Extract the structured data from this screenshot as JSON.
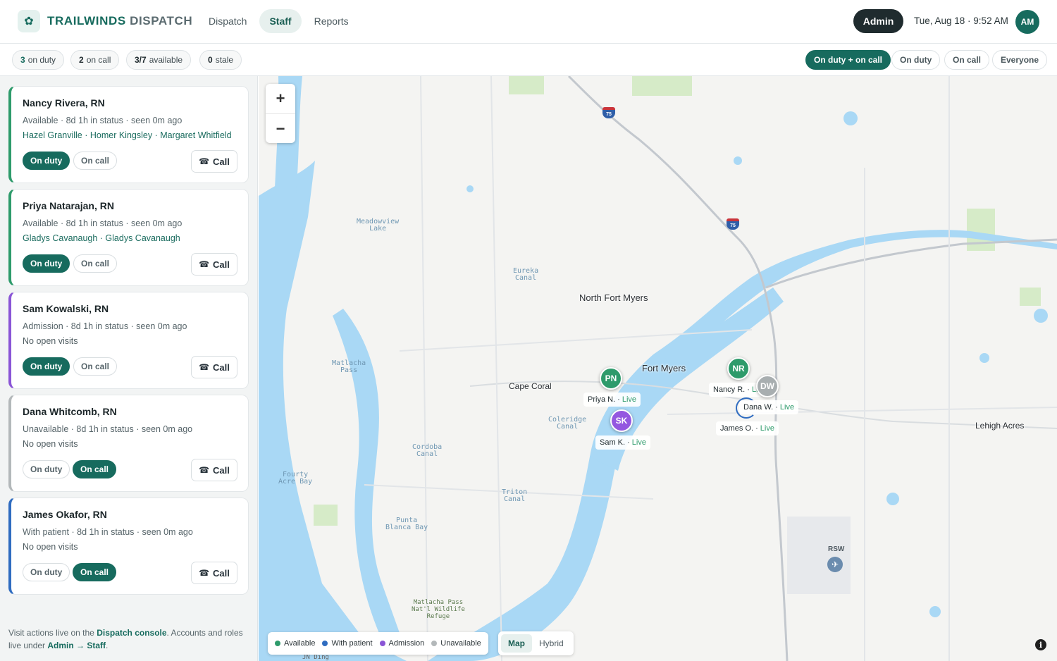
{
  "header": {
    "brand_primary": "TRAILWINDS",
    "brand_secondary": "DISPATCH",
    "brand_icon": "butterfly-icon",
    "tabs": [
      {
        "label": "Dispatch",
        "active": false
      },
      {
        "label": "Staff",
        "active": true
      },
      {
        "label": "Reports",
        "active": false
      }
    ],
    "admin_label": "Admin",
    "datetime": "Tue, Aug 18 · 9:52 AM",
    "avatar_initials": "AM"
  },
  "stats": [
    {
      "count": "3",
      "label": "on duty"
    },
    {
      "count": "2",
      "label": "on call"
    },
    {
      "count": "3/7",
      "label": "available"
    },
    {
      "count": "0",
      "label": "stale"
    }
  ],
  "filters": [
    {
      "label": "On duty + on call",
      "active": true
    },
    {
      "label": "On duty",
      "active": false
    },
    {
      "label": "On call",
      "active": false
    },
    {
      "label": "Everyone",
      "active": false
    }
  ],
  "staff": [
    {
      "name": "Nancy Rivera, RN",
      "status": "Available · 8d 1h in status · seen 0m ago",
      "visits": "Hazel Granville · Homer Kingsley · Margaret Whitfield",
      "on_duty_label": "On duty",
      "on_call_label": "On call",
      "mode": "on_duty",
      "call_label": "Call",
      "kind": "available"
    },
    {
      "name": "Priya Natarajan, RN",
      "status": "Available · 8d 1h in status · seen 0m ago",
      "visits": "Gladys Cavanaugh · Gladys Cavanaugh",
      "on_duty_label": "On duty",
      "on_call_label": "On call",
      "mode": "on_duty",
      "call_label": "Call",
      "kind": "available"
    },
    {
      "name": "Sam Kowalski, RN",
      "status": "Admission · 8d 1h in status · seen 0m ago",
      "visits": "No open visits",
      "on_duty_label": "On duty",
      "on_call_label": "On call",
      "mode": "on_duty",
      "call_label": "Call",
      "kind": "admission"
    },
    {
      "name": "Dana Whitcomb, RN",
      "status": "Unavailable · 8d 1h in status · seen 0m ago",
      "visits": "No open visits",
      "on_duty_label": "On duty",
      "on_call_label": "On call",
      "mode": "on_call",
      "call_label": "Call",
      "kind": "unavailable"
    },
    {
      "name": "James Okafor, RN",
      "status": "With patient · 8d 1h in status · seen 0m ago",
      "visits": "No open visits",
      "on_duty_label": "On duty",
      "on_call_label": "On call",
      "mode": "on_call",
      "call_label": "Call",
      "kind": "with_patient"
    }
  ],
  "footer": {
    "t1": "Visit actions live on the ",
    "link1": "Dispatch console",
    "t2": ". Accounts and roles live under ",
    "link2": "Admin → Staff",
    "t3": "."
  },
  "map": {
    "zoom_in": "+",
    "zoom_out": "−",
    "places": {
      "north_fort_myers": "North Fort Myers",
      "fort_myers": "Fort Myers",
      "cape_coral": "Cape Coral",
      "lehigh_acres": "Lehigh Acres"
    },
    "water": {
      "meadowview_1": "Meadowview",
      "meadowview_2": "Lake",
      "eureka_1": "Eureka",
      "eureka_2": "Canal",
      "matlacha_1": "Matlacha",
      "matlacha_2": "Pass",
      "coleridge_1": "Coleridge",
      "coleridge_2": "Canal",
      "cordoba_1": "Cordoba",
      "cordoba_2": "Canal",
      "fourty_1": "Fourty",
      "fourty_2": "Acre Bay",
      "triton_1": "Triton",
      "triton_2": "Canal",
      "punta_1": "Punta",
      "punta_2": "Blanca Bay"
    },
    "park": {
      "l1": "Matlacha Pass",
      "l2": "Nat'l Wildlife",
      "l3": "Refuge"
    },
    "road_bottom": "JN Ding",
    "shield_75": "75",
    "airport_code": "RSW",
    "markers": {
      "pn": "PN",
      "sk": "SK",
      "nr": "NR",
      "dw": "DW",
      "priya": "Priya N. ·",
      "sam": "Sam K. ·",
      "nancy": "Nancy R. ·",
      "dana": "Dana W. ·",
      "james": "James O. ·",
      "live": "Live",
      "live_cut": "Li"
    },
    "legend": [
      {
        "label": "Available",
        "color": "#2e9b6b"
      },
      {
        "label": "With patient",
        "color": "#2f6cc0"
      },
      {
        "label": "Admission",
        "color": "#8a55d6"
      },
      {
        "label": "Unavailable",
        "color": "#b3b8ba"
      }
    ],
    "map_types": [
      {
        "label": "Map",
        "active": true
      },
      {
        "label": "Hybrid",
        "active": false
      }
    ],
    "info": "i"
  }
}
